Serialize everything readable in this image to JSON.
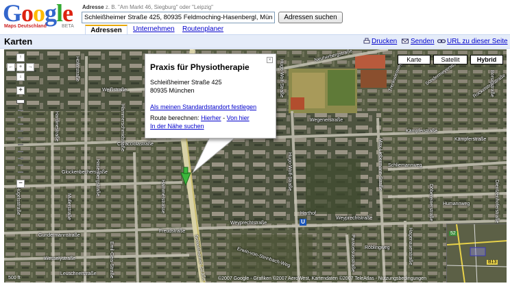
{
  "logo": {
    "letters": [
      "G",
      "o",
      "o",
      "g",
      "l",
      "e"
    ],
    "colors": [
      "#3366cc",
      "#dd2211",
      "#ffbb00",
      "#3366cc",
      "#33aa33",
      "#dd2211"
    ],
    "subtitle": "Maps Deutschland",
    "beta": "BETA"
  },
  "search": {
    "label": "Adresse",
    "examples": "z. B. \"Am Markt 46, Siegburg\" oder \"Leipzig\"",
    "value": "Schleißheimer Straße 425, 80935 Feldmoching-Hasenbergl, Mün",
    "button": "Adressen suchen"
  },
  "tabs": {
    "active": "Adressen",
    "businesses": "Unternehmen",
    "routes": "Routenplaner"
  },
  "header": {
    "title": "Karten",
    "print": "Drucken",
    "send": "Senden",
    "link_url": "URL zu dieser Seite"
  },
  "map_type": {
    "map": "Karte",
    "satellite": "Satellit",
    "hybrid": "Hybrid",
    "selected": "Hybrid"
  },
  "pan": {
    "up": "↑",
    "down": "↓",
    "left": "←",
    "right": "→",
    "center": "+"
  },
  "zoom": {
    "plus": "+",
    "minus": "−"
  },
  "info_window": {
    "title": "Praxis für Physiotherapie",
    "street": "Schleißheimer Straße 425",
    "city": "80935 München",
    "set_default": "Als meinen Standardstandort festlegen",
    "route_label": "Route berechnen:",
    "route_to": "Hierher",
    "route_sep": "-",
    "route_from": "Von hier",
    "nearby": "In der Nähe suchen",
    "close": "×"
  },
  "streets": {
    "neuherbergstrasse": "Neuherbergstraße",
    "rockelsteinstrasse": "Rockelsteinstraße",
    "weissstrasse": "Weißstraße",
    "caracciolastrasse": "Caracciolastraße",
    "glockenbecherstrasse": "Glockenbecherstraße",
    "hasenbergstrasse": "Hasenbergstraße",
    "hardinestrasse": "Hardinestraße",
    "hoeferstrasse": "Höferstraße",
    "huegelsstrasse": "Hügelsstraße",
    "hugo_wolf": "Hugo-Wolf-Straße",
    "hugo_wolf2": "Hugo-Wolf-Straße",
    "wegenerstrasse": "Wegenerstraße",
    "trenkwiesweg": "Trenkwiesweg",
    "kaempferstrasse": "Kämpferstraße",
    "kaempferstrasse2": "Kämpferstraße",
    "max_liebermann": "Max-Liebermann-Straße",
    "schliemannweg": "Schliemannweg",
    "humannweg": "Humannweg",
    "dientzenhofer": "Dientzenhoferstraße",
    "hammerstrasse": "Hammerstrasse",
    "weyprechtstrasse": "Weyprechtstraße",
    "weyprechtstrasse2": "Weyprechtstraße",
    "harthof": "Harthof",
    "freudstrasse": "Freudstraße",
    "gundermannstrasse": "Gundermannstraße",
    "wesselystrasse": "Wesselystraße",
    "leuschnerstrasse": "Leuschnerstraße",
    "schleissheimer": "Schleißheimer Straße",
    "erwin_von_steinbach": "Erwin-von-Steinbach-Weg",
    "roeblingweg": "Röblingweg",
    "paracelsusstrasse": "Paracelsusstraße",
    "hagenauer": "Hagenauerstraße",
    "doebereinerstrasse": "Döbereinerstraße",
    "sondermeyerstr": "Sondermeyerstraße",
    "borsigstrasse": "Borsigstraße",
    "emil_geis": "Emil-Geis-Straße",
    "mullerstrasse": "Mullerstraße",
    "hammerschmid": "Hammerschmidstraße"
  },
  "ubahn": "U",
  "minimap": {
    "road1": "B13",
    "road2": "52"
  },
  "footer": {
    "scale": "500 ft",
    "copyright": "©2007 Google - Grafiken ©2007 AeroWest, Kartendaten ©2007 TeleAtlas - Nutzungsbedingungen"
  }
}
